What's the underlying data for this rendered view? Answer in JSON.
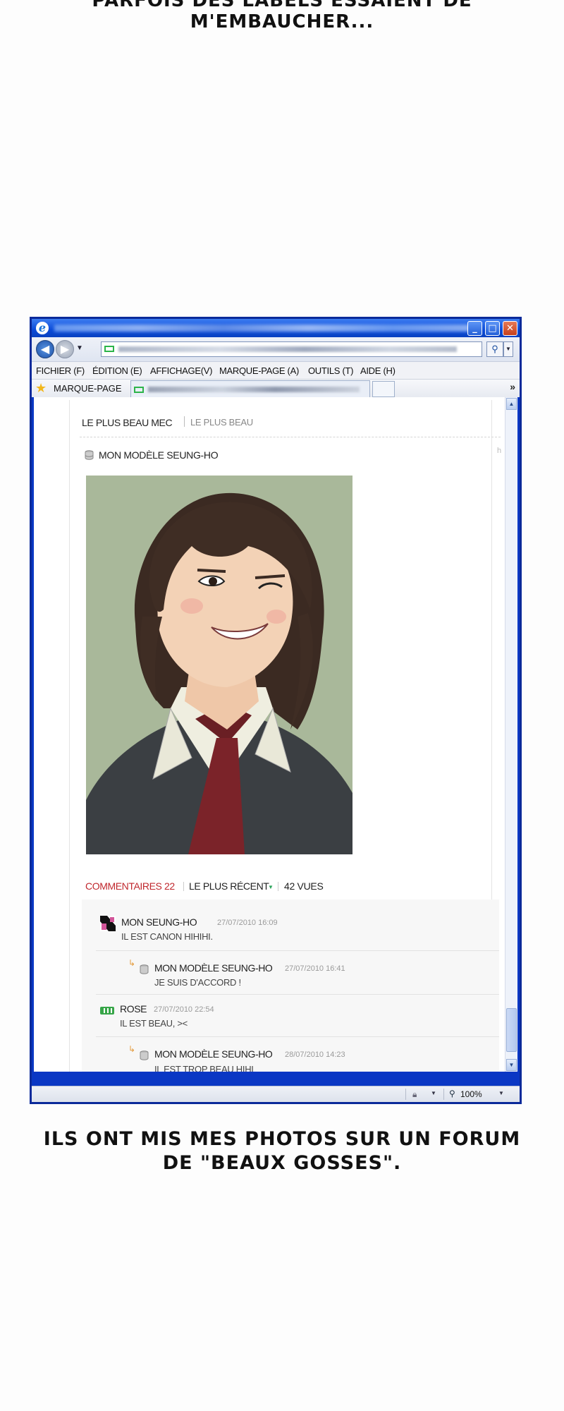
{
  "captions": {
    "top": "PARFOIS DES LABELS ESSAIENT DE M'EMBAUCHER...",
    "bottom_line1": "ILS ONT MIS MES PHOTOS SUR UN FORUM",
    "bottom_line2": "DE \"BEAUX GOSSES\"."
  },
  "browser": {
    "menu": [
      "FICHIER (F)",
      "ÉDITION (E)",
      "AFFICHAGE(V)",
      "MARQUE-PAGE (A)",
      "OUTILS (T)",
      "AIDE (H)"
    ],
    "favorites_label": "MARQUE-PAGE",
    "zoom": "100%",
    "colors": {
      "titlebar": "#0a4ad8",
      "frame": "#0b2a9a",
      "close": "#c6401c"
    }
  },
  "page": {
    "breadcrumb_main": "LE PLUS BEAU MEC",
    "breadcrumb_sub": "LE PLUS BEAU",
    "post_author": "MON MODÈLE SEUNG-HO",
    "side_text": "h",
    "comments_label": "COMMENTAIRES 22",
    "sort_label": "LE PLUS RÉCENT",
    "views": "42 VUES",
    "accent": "#c0272d"
  },
  "comments": [
    {
      "name": "MON SEUNG-HO",
      "date": "27/07/2010  16:09",
      "text": "IL EST CANON HIHIHI."
    },
    {
      "name": "MON MODÈLE SEUNG-HO",
      "date": "27/07/2010  16:41",
      "text": "JE SUIS D'ACCORD !"
    },
    {
      "name": "ROSE",
      "date": "27/07/2010  22:54",
      "text": "IL EST BEAU, ><"
    },
    {
      "name": "MON MODÈLE SEUNG-HO",
      "date": "28/07/2010  14:23",
      "text": "IL EST TROP BEAU HIHI"
    }
  ]
}
